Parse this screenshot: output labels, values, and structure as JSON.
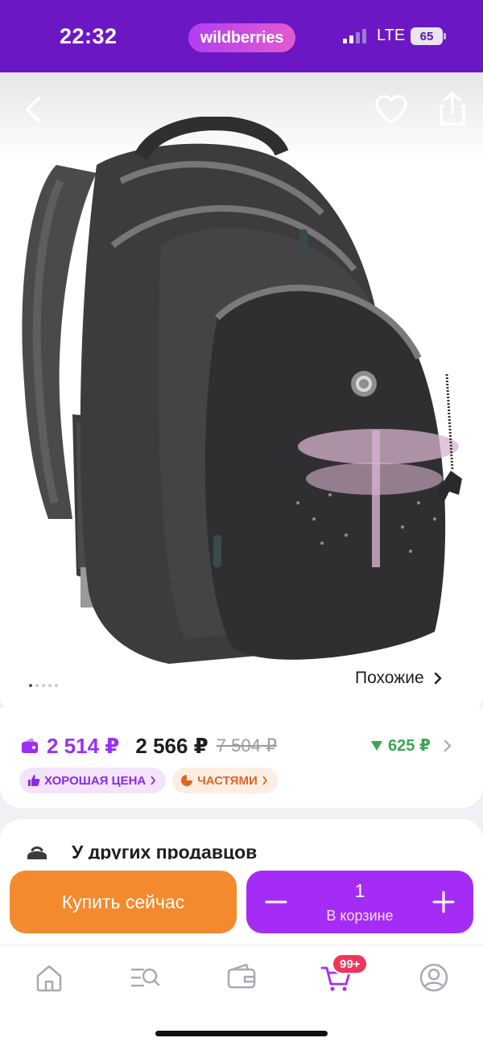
{
  "status_bar": {
    "time": "22:32",
    "brand": "wildberries",
    "network": "LTE",
    "battery": "65"
  },
  "gallery": {
    "similar_label": "Похожие",
    "image_alt": "Backpack with dragonfly rhinestone pattern"
  },
  "price": {
    "wallet_price": "2 514 ₽",
    "price": "2 566 ₽",
    "old_price": "7 504 ₽",
    "cashback": "625 ₽",
    "badges": {
      "good_price": "ХОРОШАЯ ЦЕНА",
      "installments": "ЧАСТЯМИ"
    }
  },
  "sellers": {
    "title": "У других продавцов"
  },
  "actions": {
    "buy_now": "Купить сейчас",
    "quantity": "1",
    "in_cart": "В корзине"
  },
  "tabbar": {
    "cart_count": "99+",
    "items": [
      "home-icon",
      "catalog-search-icon",
      "wallet-icon",
      "cart-icon",
      "profile-icon"
    ]
  },
  "colors": {
    "brand_purple": "#6c17c4",
    "accent_purple": "#a52cf5",
    "orange": "#f38a2e",
    "green": "#3aa655",
    "badge_red": "#f2345d"
  }
}
